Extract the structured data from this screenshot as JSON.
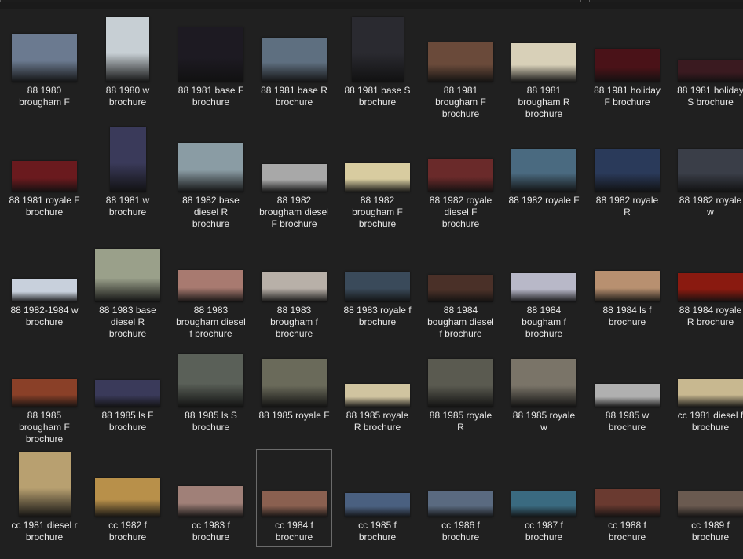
{
  "window": {
    "view": "Large icons"
  },
  "selected_index": 39,
  "files": [
    {
      "name": "88 1980 brougham F",
      "thumb_color": "#6b7a90"
    },
    {
      "name": "88 1980 w brochure",
      "thumb_color": "#c7cfd4"
    },
    {
      "name": "88 1981 base F brochure",
      "thumb_color": "#1d1a22"
    },
    {
      "name": "88 1981 base R brochure",
      "thumb_color": "#5e6f80"
    },
    {
      "name": "88 1981 base S brochure",
      "thumb_color": "#2a2a30"
    },
    {
      "name": "88 1981 brougham F brochure",
      "thumb_color": "#6a4a3a"
    },
    {
      "name": "88 1981 brougham R brochure",
      "thumb_color": "#d8d0b8"
    },
    {
      "name": "88 1981 holiday F brochure",
      "thumb_color": "#4a1218"
    },
    {
      "name": "88 1981 holiday S brochure",
      "thumb_color": "#3a1a20"
    },
    {
      "name": "88 1981 royale F brochure",
      "thumb_color": "#6a1a1e"
    },
    {
      "name": "88 1981 w brochure",
      "thumb_color": "#3a3a5a"
    },
    {
      "name": "88 1982 base diesel R brochure",
      "thumb_color": "#8a9ca4"
    },
    {
      "name": "88 1982 brougham diesel F brochure",
      "thumb_color": "#a8a8a8"
    },
    {
      "name": "88 1982 brougham F brochure",
      "thumb_color": "#d8cca0"
    },
    {
      "name": "88 1982 royale diesel F brochure",
      "thumb_color": "#6a2a2a"
    },
    {
      "name": "88 1982 royale F",
      "thumb_color": "#4a6a80"
    },
    {
      "name": "88 1982 royale R",
      "thumb_color": "#2a3a5a"
    },
    {
      "name": "88 1982 royale w",
      "thumb_color": "#3a3e48"
    },
    {
      "name": "88 1982-1984 w brochure",
      "thumb_color": "#c8d0dc"
    },
    {
      "name": "88 1983 base diesel R brochure",
      "thumb_color": "#9aa08a"
    },
    {
      "name": "88 1983 brougham diesel f brochure",
      "thumb_color": "#a87a70"
    },
    {
      "name": "88 1983 brougham f brochure",
      "thumb_color": "#b8b0a8"
    },
    {
      "name": "88 1983 royale f brochure",
      "thumb_color": "#3a4a5a"
    },
    {
      "name": "88 1984 bougham diesel f brochure",
      "thumb_color": "#4a3028"
    },
    {
      "name": "88 1984 bougham f brochure",
      "thumb_color": "#b8b8c8"
    },
    {
      "name": "88 1984 ls f brochure",
      "thumb_color": "#b89070"
    },
    {
      "name": "88 1984 royale R brochure",
      "thumb_color": "#8a1a10"
    },
    {
      "name": "88 1985 brougham F brochure",
      "thumb_color": "#8a4028"
    },
    {
      "name": "88 1985 ls F brochure",
      "thumb_color": "#3a3a5a"
    },
    {
      "name": "88 1985 ls S brochure",
      "thumb_color": "#5a6058"
    },
    {
      "name": "88 1985 royale F",
      "thumb_color": "#6a6a5a"
    },
    {
      "name": "88 1985 royale R brochure",
      "thumb_color": "#d0c4a0"
    },
    {
      "name": "88 1985 royale R",
      "thumb_color": "#5a5a50"
    },
    {
      "name": "88 1985 royale w",
      "thumb_color": "#7a7468"
    },
    {
      "name": "88 1985 w brochure",
      "thumb_color": "#b0b0b0"
    },
    {
      "name": "cc 1981 diesel f brochure",
      "thumb_color": "#c8b890"
    },
    {
      "name": "cc 1981 diesel r brochure",
      "thumb_color": "#b8a070"
    },
    {
      "name": "cc 1982 f brochure",
      "thumb_color": "#b8904a"
    },
    {
      "name": "cc 1983 f brochure",
      "thumb_color": "#a08078"
    },
    {
      "name": "cc 1984 f brochure",
      "thumb_color": "#8a6050"
    },
    {
      "name": "cc 1985 f brochure",
      "thumb_color": "#4a6080"
    },
    {
      "name": "cc 1986 f brochure",
      "thumb_color": "#5a6a80"
    },
    {
      "name": "cc 1987 f brochure",
      "thumb_color": "#3a6a80"
    },
    {
      "name": "cc 1988 f brochure",
      "thumb_color": "#6a3a30"
    },
    {
      "name": "cc 1989 f brochure",
      "thumb_color": "#6a5a50"
    }
  ]
}
